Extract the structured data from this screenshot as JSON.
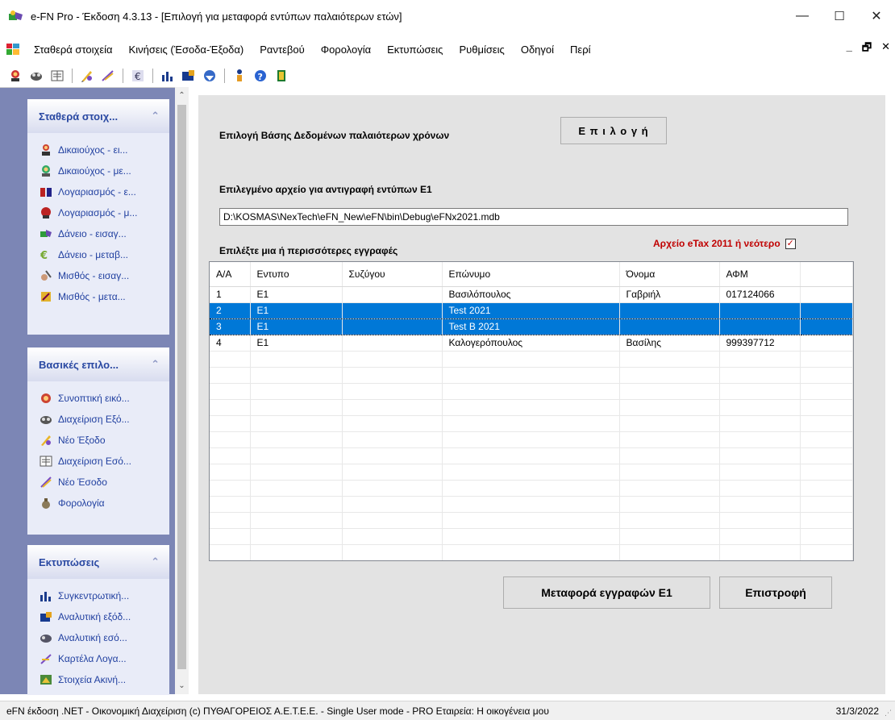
{
  "window": {
    "title": "e-FN Pro  - Έκδοση 4.3.13 - [Επιλογή για μεταφορά εντύπων παλαιότερων ετών]",
    "minimize": "—",
    "maximize": "☐",
    "close": "✕"
  },
  "menu": {
    "items": [
      "Σταθερά στοιχεία",
      "Κινήσεις (Έσοδα-Έξοδα)",
      "Ραντεβού",
      "Φορολογία",
      "Εκτυπώσεις",
      "Ρυθμίσεις",
      "Οδηγοί",
      "Περί"
    ],
    "mdi_min": "_",
    "mdi_restore": "🗗",
    "mdi_close": "✕"
  },
  "sidebar": {
    "groups": [
      {
        "title": "Σταθερά στοιχ...",
        "items": [
          "Δικαιούχος - ει...",
          "Δικαιούχος - με...",
          "Λογαριασμός - ε...",
          "Λογαριασμός - μ...",
          "Δάνειο - εισαγ...",
          "Δάνειο - μεταβ...",
          "Μισθός - εισαγ...",
          "Μισθός - μετα..."
        ]
      },
      {
        "title": "Βασικές επιλο...",
        "items": [
          "Συνοπτική εικό...",
          "Διαχείριση Εξό...",
          "Νέο Έξοδο",
          "Διαχείριση Εσό...",
          "Νέο Έσοδο",
          "Φορολογία"
        ]
      },
      {
        "title": "Εκτυπώσεις",
        "items": [
          "Συγκεντρωτική...",
          "Αναλυτική εξόδ...",
          "Αναλυτική εσό...",
          "Καρτέλα Λογα...",
          "Στοιχεία Ακινή..."
        ]
      }
    ]
  },
  "main": {
    "select_db_label": "Επιλογή Βάσης Δεδομένων παλαιότερων χρόνων",
    "select_button": "Ε π ι λ ο γ ή",
    "selected_file_label": "Επιλεγμένο αρχείο για αντιγραφή εντύπων Ε1",
    "file_path": "D:\\KOSMAS\\NexTech\\eFN_New\\eFN\\bin\\Debug\\eFNx2021.mdb",
    "etax_label": "Αρχείο eTax 2011 ή νεότερο",
    "etax_checked": true,
    "records_label": "Επιλέξτε μια ή περισσότερες εγγραφές",
    "transfer_button": "Μεταφορά εγγραφών Ε1",
    "back_button": "Επιστροφή"
  },
  "grid": {
    "columns": [
      "Α/Α",
      "Εντυπο",
      "Συζύγου",
      "Επώνυμο",
      "Όνομα",
      "ΑΦΜ",
      ""
    ],
    "rows": [
      {
        "cells": [
          "1",
          "E1",
          "",
          "Βασιλόπουλος",
          "Γαβριήλ",
          "017124066",
          ""
        ],
        "selected": false
      },
      {
        "cells": [
          "2",
          "E1",
          "",
          "Test 2021",
          "",
          "",
          ""
        ],
        "selected": true
      },
      {
        "cells": [
          "3",
          "E1",
          "",
          "Test B 2021",
          "",
          "",
          ""
        ],
        "selected": true
      },
      {
        "cells": [
          "4",
          "E1",
          "",
          "Καλογερόπουλος",
          "Βασίλης",
          "999397712",
          ""
        ],
        "selected": false
      }
    ]
  },
  "status": {
    "text": "eFN έκδοση .NET - Οικονομική Διαχείριση  (c) ΠΥΘΑΓΟΡΕΙΟΣ  Α.Ε.Τ.Ε.Ε. - Single User mode - PRO  Εταιρεία: Η οικογένεια μου",
    "date": "31/3/2022"
  }
}
